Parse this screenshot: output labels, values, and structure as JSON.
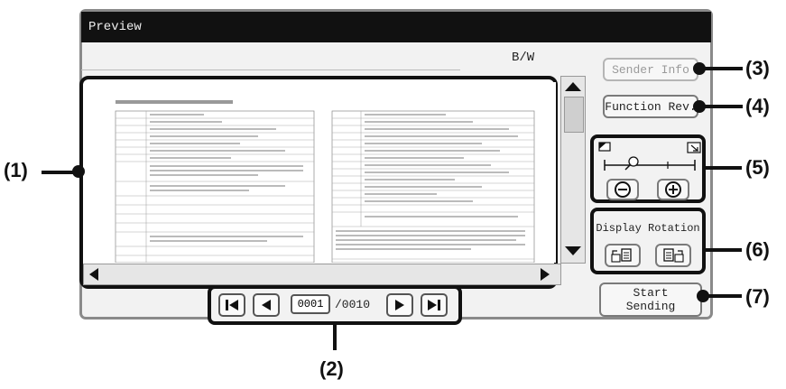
{
  "window": {
    "title": "Preview",
    "color_mode": "B/W"
  },
  "buttons": {
    "sender_info": "Sender Info",
    "function_rev": "Function Rev.",
    "start_sending_line1": "Start",
    "start_sending_line2": "Sending"
  },
  "rotation": {
    "label": "Display Rotation"
  },
  "pagination": {
    "current": "0001",
    "total": "/0010"
  },
  "callouts": {
    "c1": "(1)",
    "c2": "(2)",
    "c3": "(3)",
    "c4": "(4)",
    "c5": "(5)",
    "c6": "(6)",
    "c7": "(7)"
  }
}
